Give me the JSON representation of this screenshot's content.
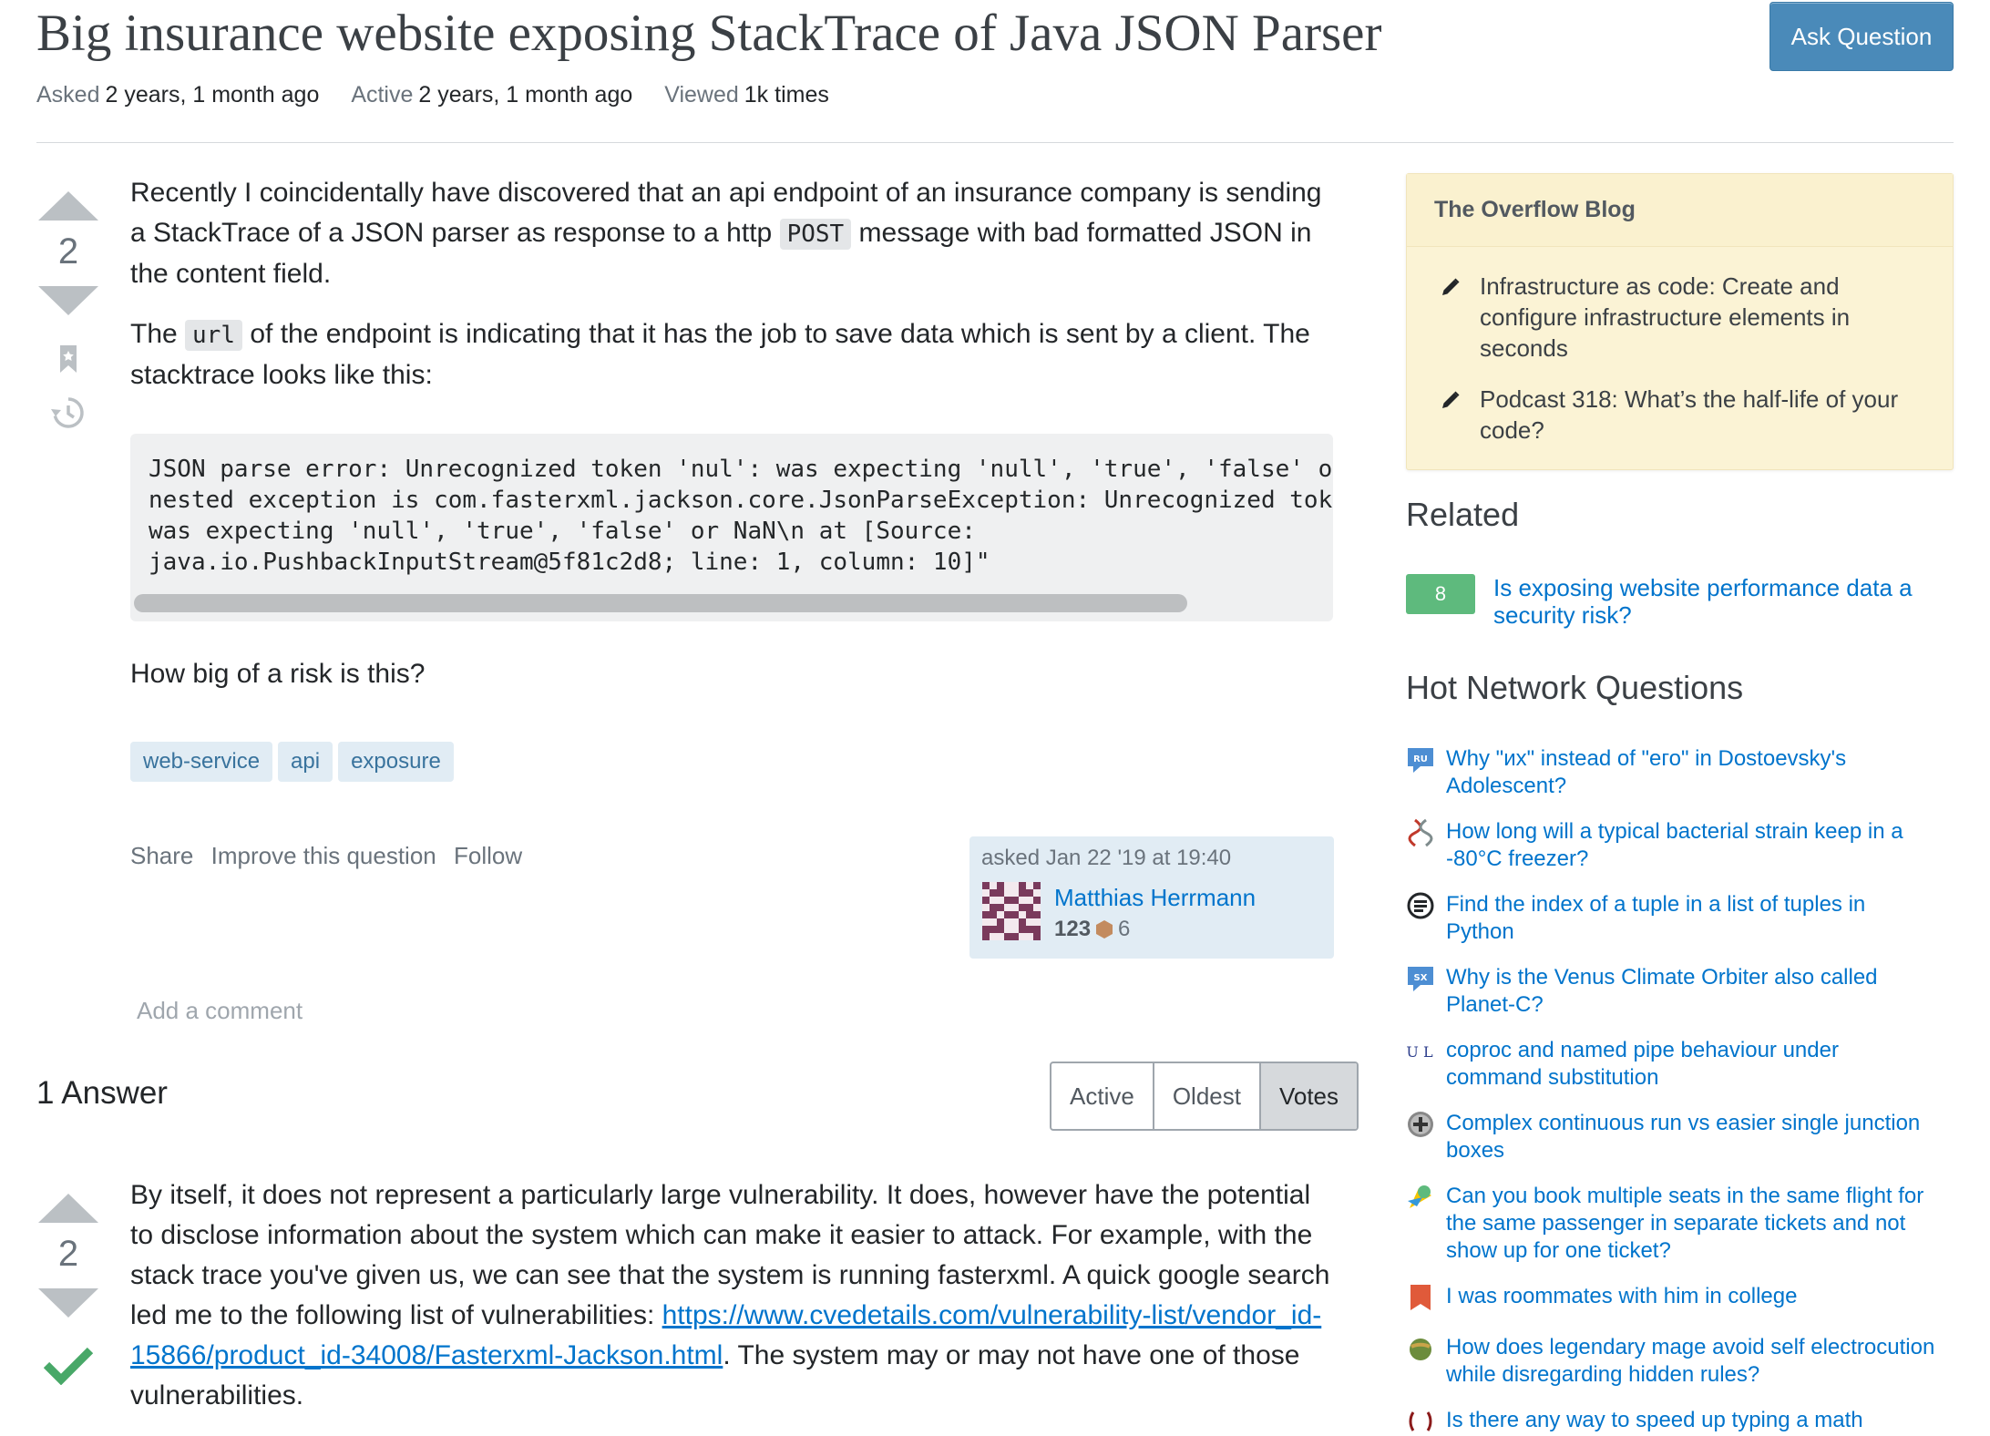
{
  "question": {
    "title": "Big insurance website exposing StackTrace of Java JSON Parser",
    "ask_button": "Ask Question",
    "meta": {
      "asked_label": "Asked",
      "asked_value": "2 years, 1 month ago",
      "active_label": "Active",
      "active_value": "2 years, 1 month ago",
      "viewed_label": "Viewed",
      "viewed_value": "1k times"
    },
    "votes": "2",
    "body": {
      "p1_a": "Recently I coincidentally have discovered that an api endpoint of an insurance company is sending a StackTrace of a JSON parser as response to a http ",
      "p1_code": "POST",
      "p1_b": " message with bad formatted JSON in the content field.",
      "p2_a": "The ",
      "p2_code": "url",
      "p2_b": " of the endpoint is indicating that it has the job to save data which is sent by a client. The stacktrace looks like this:",
      "code": "JSON parse error: Unrecognized token 'nul': was expecting 'null', 'true', 'false' o\nnested exception is com.fasterxml.jackson.core.JsonParseException: Unrecognized tok\nwas expecting 'null', 'true', 'false' or NaN\\n at [Source:\njava.io.PushbackInputStream@5f81c2d8; line: 1, column: 10]\"",
      "p3": "How big of a risk is this?"
    },
    "tags": [
      "web-service",
      "api",
      "exposure"
    ],
    "menu": {
      "share": "Share",
      "improve": "Improve this question",
      "follow": "Follow"
    },
    "owner": {
      "asked": "asked Jan 22 '19 at 19:40",
      "name": "Matthias Herrmann",
      "rep": "123",
      "bronze": "6"
    },
    "add_comment": "Add a comment"
  },
  "answers": {
    "title": "1 Answer",
    "sort_tabs": [
      "Active",
      "Oldest",
      "Votes"
    ],
    "active_tab": "Votes",
    "first": {
      "votes": "2",
      "text_a": "By itself, it does not represent a particularly large vulnerability. It does, however have the potential to disclose information about the system which can make it easier to attack. For example, with the stack trace you've given us, we can see that the system is running fasterxml. A quick google search led me to the following list of vulnerabilities: ",
      "link": "https://www.cvedetails.com/vulnerability-list/vendor_id-15866/product_id-34008/Fasterxml-Jackson.html",
      "text_b": ". The system may or may not have one of those vulnerabilities."
    }
  },
  "sidebar": {
    "blog_title": "The Overflow Blog",
    "blog_items": [
      "Infrastructure as code: Create and configure infrastructure elements in seconds",
      "Podcast 318: What’s the half-life of your code?"
    ],
    "related_title": "Related",
    "related": [
      {
        "score": "8",
        "title": "Is exposing website performance data a security risk?"
      }
    ],
    "hnq_title": "Hot Network Questions",
    "hnq": [
      {
        "icon": "russian-site-icon",
        "icon_text": "RU",
        "title": "Why \"их\" instead of \"его\" in Dostoevsky's Adolescent?"
      },
      {
        "icon": "biology-site-icon",
        "title": "How long will a typical bacterial strain keep in a -80°C freezer?"
      },
      {
        "icon": "stackoverflow-site-icon",
        "title": "Find the index of a tuple in a list of tuples in Python"
      },
      {
        "icon": "space-site-icon",
        "icon_text": "SX",
        "title": "Why is the Venus Climate Orbiter also called Planet-C?"
      },
      {
        "icon": "unix-site-icon",
        "icon_text": "U L",
        "title": "coproc and named pipe behaviour under command substitution"
      },
      {
        "icon": "electronics-site-icon",
        "title": "Complex continuous run vs easier single junction boxes"
      },
      {
        "icon": "travel-site-icon",
        "title": "Can you book multiple seats in the same flight for the same passenger in separate tickets and not show up for one ticket?"
      },
      {
        "icon": "interpersonal-site-icon",
        "title": "I was roommates with him in college"
      },
      {
        "icon": "worldbuilding-site-icon",
        "title": "How does legendary mage avoid self electrocution while disregarding hidden rules?"
      },
      {
        "icon": "tex-site-icon",
        "title": "Is there any way to speed up typing a math"
      }
    ]
  },
  "colors": {
    "link": "#0074cc",
    "ask_button": "#4a8ab9",
    "tag_bg": "#e1ecf4",
    "accepted_check": "#48a868",
    "blog_bg": "#fbf3d5",
    "related_score_bg": "#5eba7d"
  }
}
